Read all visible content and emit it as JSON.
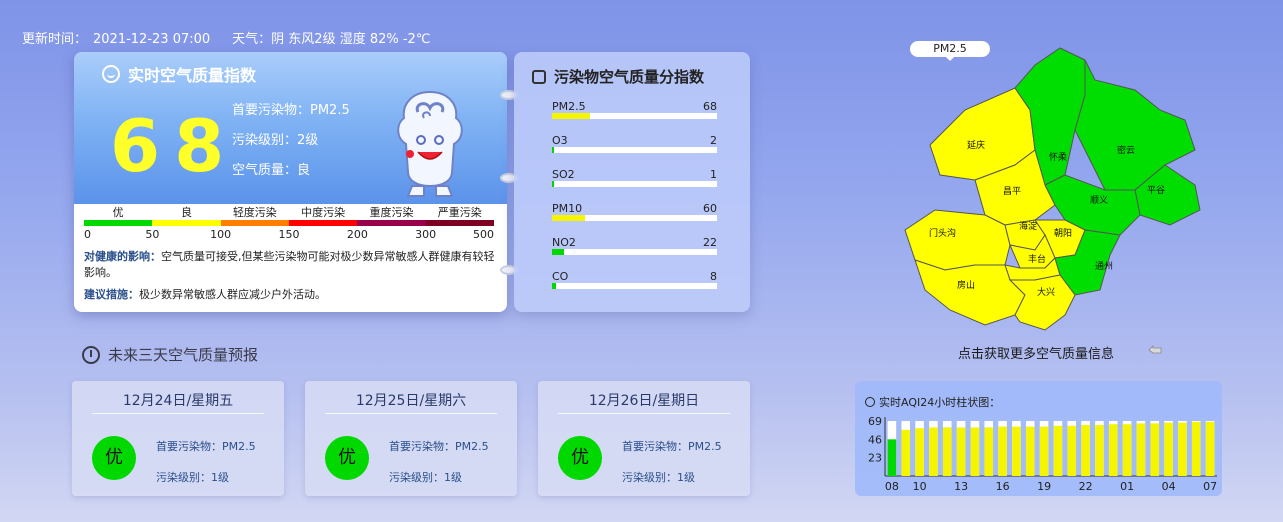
{
  "topbar": {
    "update_label": "更新时间：",
    "update_time": "2021-12-23 07:00",
    "weather": "天气：阴 东风2级 湿度 82% -2℃"
  },
  "aqi": {
    "title": "实时空气质量指数",
    "value": "68",
    "primary": "首要污染物：PM2.5",
    "level": "污染级别：2级",
    "quality": "空气质量：良",
    "scale_labels": [
      "优",
      "良",
      "轻度污染",
      "中度污染",
      "重度污染",
      "严重污染"
    ],
    "scale_colors": [
      "#00d800",
      "#ffff00",
      "#ff7e00",
      "#ff0000",
      "#99004c",
      "#7e0023"
    ],
    "scale_ticks": [
      "0",
      "50",
      "100",
      "150",
      "200",
      "300",
      "500"
    ],
    "health_label": "对健康的影响：",
    "health_text": "空气质量可接受,但某些污染物可能对极少数异常敏感人群健康有较轻影响。",
    "advice_label": "建议措施：",
    "advice_text": "极少数异常敏感人群应减少户外活动。"
  },
  "pollutants": {
    "title": "污染物空气质量分指数",
    "items": [
      {
        "name": "PM2.5",
        "value": "68",
        "fraction": 0.23,
        "color": "#f5f500"
      },
      {
        "name": "O3",
        "value": "2",
        "fraction": 0.006,
        "color": "#00d800"
      },
      {
        "name": "SO2",
        "value": "1",
        "fraction": 0.003,
        "color": "#00d800"
      },
      {
        "name": "PM10",
        "value": "60",
        "fraction": 0.2,
        "color": "#f5f500"
      },
      {
        "name": "NO2",
        "value": "22",
        "fraction": 0.07,
        "color": "#00d800"
      },
      {
        "name": "CO",
        "value": "8",
        "fraction": 0.025,
        "color": "#00d800"
      }
    ]
  },
  "forecast": {
    "title": "未来三天空气质量预报",
    "days": [
      {
        "date": "12月24日/星期五",
        "badge": "优",
        "primary": "首要污染物：PM2.5",
        "level": "污染级别：1级"
      },
      {
        "date": "12月25日/星期六",
        "badge": "优",
        "primary": "首要污染物：PM2.5",
        "level": "污染级别：1级"
      },
      {
        "date": "12月26日/星期日",
        "badge": "优",
        "primary": "首要污染物：PM2.5",
        "level": "污染级别：1级"
      }
    ]
  },
  "map": {
    "label": "PM2.5",
    "link": "点击获取更多空气质量信息",
    "districts": [
      "延庆",
      "怀柔",
      "密云",
      "昌平",
      "平谷",
      "顺义",
      "门头沟",
      "海淀",
      "朝阳",
      "丰台",
      "通州",
      "房山",
      "大兴"
    ],
    "green": "#00dd00",
    "yellow": "#ffff00"
  },
  "chart_data": {
    "type": "bar",
    "title": "实时AQI24小时柱状图：",
    "yticks": [
      "69",
      "46",
      "23"
    ],
    "xticks": [
      "08",
      "10",
      "13",
      "16",
      "19",
      "22",
      "01",
      "04",
      "07"
    ],
    "ylim": [
      0,
      69
    ],
    "values": [
      46,
      58,
      60,
      61,
      61,
      61,
      61,
      61,
      62,
      62,
      62,
      62,
      63,
      63,
      64,
      64,
      65,
      65,
      66,
      66,
      67,
      67,
      68,
      68
    ],
    "colors": [
      "#00d800",
      "#f5f500"
    ]
  }
}
